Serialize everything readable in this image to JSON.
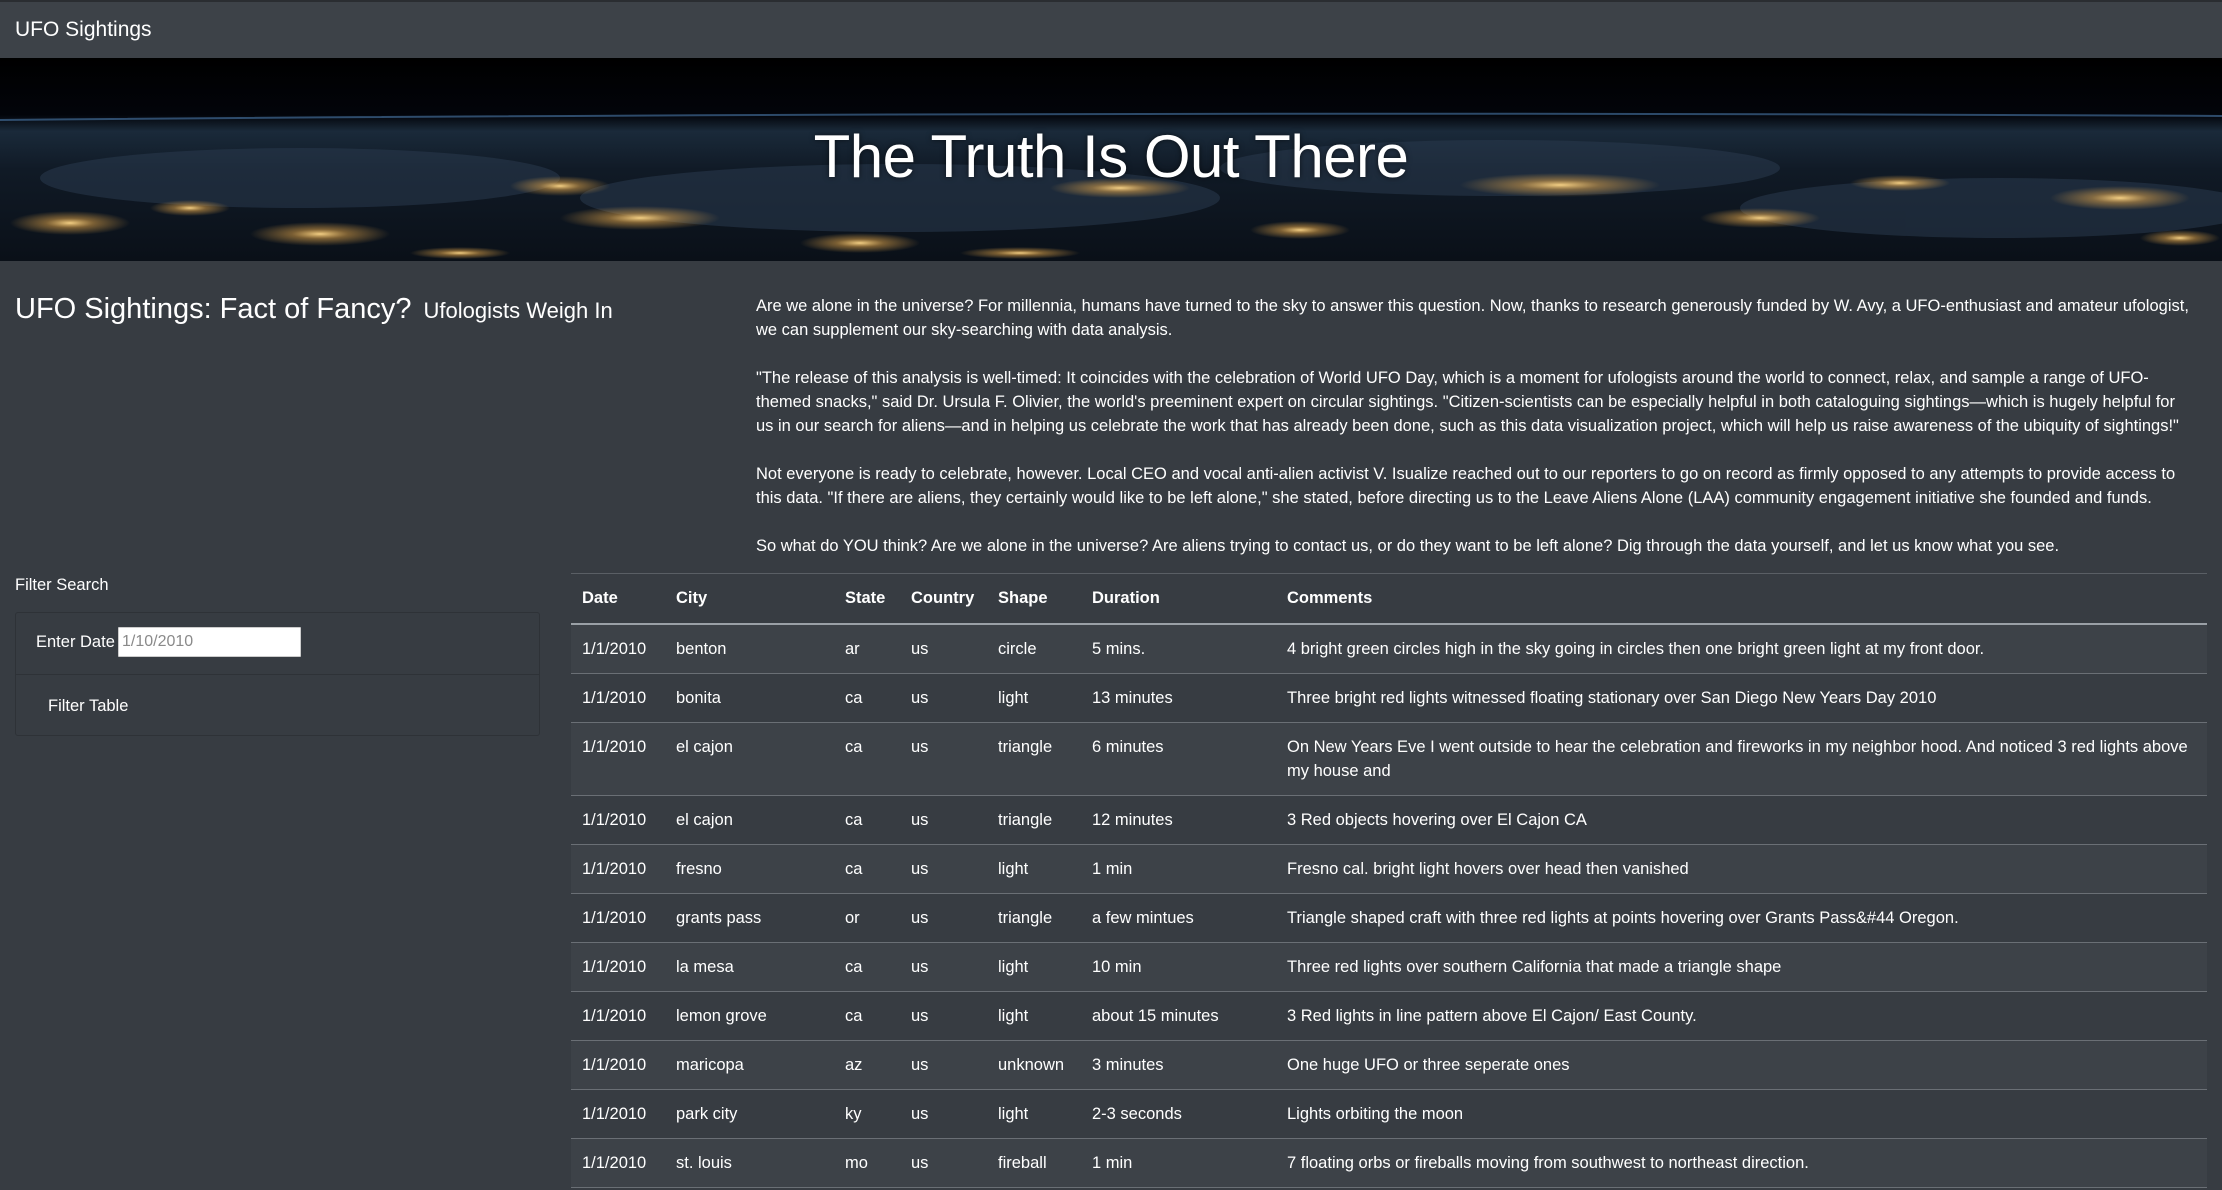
{
  "navbar": {
    "brand": "UFO Sightings"
  },
  "hero": {
    "title": "The Truth Is Out There"
  },
  "headline": {
    "main": "UFO Sightings: Fact of Fancy?",
    "sub": "Ufologists Weigh In"
  },
  "article": {
    "paragraphs": [
      "Are we alone in the universe? For millennia, humans have turned to the sky to answer this question. Now, thanks to research generously funded by W. Avy, a UFO-enthusiast and amateur ufologist, we can supplement our sky-searching with data analysis.",
      "\"The release of this analysis is well-timed: It coincides with the celebration of World UFO Day, which is a moment for ufologists around the world to connect, relax, and sample a range of UFO-themed snacks,\" said Dr. Ursula F. Olivier, the world's preeminent expert on circular sightings. \"Citizen-scientists can be especially helpful in both cataloguing sightings—which is hugely helpful for us in our search for aliens—and in helping us celebrate the work that has already been done, such as this data visualization project, which will help us raise awareness of the ubiquity of sightings!\"",
      "Not everyone is ready to celebrate, however. Local CEO and vocal anti-alien activist V. Isualize reached out to our reporters to go on record as firmly opposed to any attempts to provide access to this data. \"If there are aliens, they certainly would like to be left alone,\" she stated, before directing us to the Leave Aliens Alone (LAA) community engagement initiative she founded and funds.",
      "So what do YOU think? Are we alone in the universe? Are aliens trying to contact us, or do they want to be left alone? Dig through the data yourself, and let us know what you see."
    ]
  },
  "filter": {
    "heading": "Filter Search",
    "date_label": "Enter Date",
    "date_placeholder": "1/10/2010",
    "date_value": "",
    "button_label": "Filter Table"
  },
  "table": {
    "headers": [
      "Date",
      "City",
      "State",
      "Country",
      "Shape",
      "Duration",
      "Comments"
    ],
    "rows": [
      [
        "1/1/2010",
        "benton",
        "ar",
        "us",
        "circle",
        "5 mins.",
        "4 bright green circles high in the sky going in circles then one bright green light at my front door."
      ],
      [
        "1/1/2010",
        "bonita",
        "ca",
        "us",
        "light",
        "13 minutes",
        "Three bright red lights witnessed floating stationary over San Diego New Years Day 2010"
      ],
      [
        "1/1/2010",
        "el cajon",
        "ca",
        "us",
        "triangle",
        "6 minutes",
        "On New Years Eve I went outside to hear the celebration and fireworks in my neighbor hood. And noticed 3 red lights above my house and"
      ],
      [
        "1/1/2010",
        "el cajon",
        "ca",
        "us",
        "triangle",
        "12 minutes",
        "3 Red objects hovering over El Cajon CA"
      ],
      [
        "1/1/2010",
        "fresno",
        "ca",
        "us",
        "light",
        "1 min",
        "Fresno cal. bright light hovers over head then vanished"
      ],
      [
        "1/1/2010",
        "grants pass",
        "or",
        "us",
        "triangle",
        "a few mintues",
        "Triangle shaped craft with three red lights at points hovering over Grants Pass&#44 Oregon."
      ],
      [
        "1/1/2010",
        "la mesa",
        "ca",
        "us",
        "light",
        "10 min",
        "Three red lights over southern California that made a triangle shape"
      ],
      [
        "1/1/2010",
        "lemon grove",
        "ca",
        "us",
        "light",
        "about 15 minutes",
        "3 Red lights in line pattern above El Cajon/ East County."
      ],
      [
        "1/1/2010",
        "maricopa",
        "az",
        "us",
        "unknown",
        "3 minutes",
        "One huge UFO or three seperate ones"
      ],
      [
        "1/1/2010",
        "park city",
        "ky",
        "us",
        "light",
        "2-3 seconds",
        "Lights orbiting the moon"
      ],
      [
        "1/1/2010",
        "st. louis",
        "mo",
        "us",
        "fireball",
        "1 min",
        "7 floating orbs or fireballs moving from southwest to northeast direction."
      ]
    ]
  },
  "colors": {
    "page_bg": "#373c42",
    "navbar_bg": "#3d4248",
    "row_stripe": "#3d4248",
    "text": "#ffffff"
  }
}
